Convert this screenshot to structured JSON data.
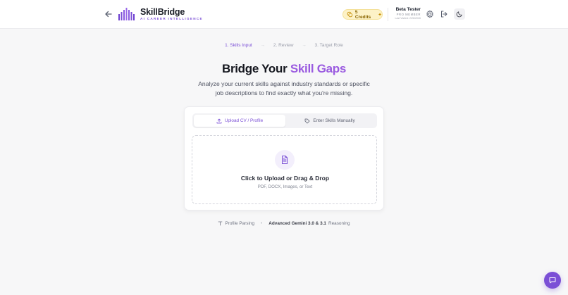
{
  "header": {
    "brand": "SkillBridge",
    "tagline": "AI CAREER INTELLIGENCE",
    "credits_label": "5 Credits",
    "user_name": "Beta Tester",
    "user_role": "PRO MEMBER",
    "user_last_visited": "Last Visited: 2/26/2026",
    "icons": [
      "arrow-left-icon",
      "logo-icon",
      "coin-icon",
      "plus-icon",
      "settings-icon",
      "logout-icon",
      "moon-icon"
    ]
  },
  "steps": [
    {
      "label": "1. Skills Input",
      "active": true
    },
    {
      "label": "2. Review",
      "active": false
    },
    {
      "label": "3. Target Role",
      "active": false
    }
  ],
  "step_separator": "→",
  "hero": {
    "title_main": "Bridge Your",
    "title_accent": "Skill Gaps",
    "subtitle": "Analyze your current skills against industry standards or specific job descriptions to find exactly what you're missing."
  },
  "tabs": {
    "upload_label": "Upload CV / Profile",
    "manual_label": "Enter Skills Manually"
  },
  "dropzone": {
    "title": "Click to Upload or Drag & Drop",
    "formats": "PDF, DOCX, Images, or Text"
  },
  "footer": {
    "parsing_label": "Profile Parsing",
    "separator": "•",
    "engine": "Advanced Gemini 3.0 & 3.1",
    "reasoning": "Reasoning"
  },
  "colors": {
    "accent": "#7b4fd6",
    "title_accent": "#9a5ae0",
    "credits_bg": "#fdf2c7",
    "background": "#f7f7f8"
  }
}
